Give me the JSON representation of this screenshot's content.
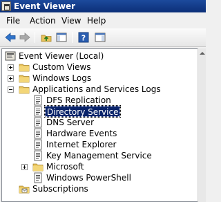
{
  "window": {
    "title": "Event Viewer",
    "app_icon": "event-viewer-icon"
  },
  "menu": {
    "items": [
      "File",
      "Action",
      "View",
      "Help"
    ]
  },
  "toolbar": {
    "buttons": [
      {
        "icon": "back-arrow-icon"
      },
      {
        "icon": "forward-arrow-icon"
      },
      {
        "icon": "up-folder-icon"
      },
      {
        "icon": "show-hide-console-tree-icon"
      },
      {
        "icon": "help-icon"
      },
      {
        "icon": "show-hide-action-pane-icon"
      }
    ]
  },
  "tree": {
    "root": "Event Viewer (Local)",
    "items": [
      {
        "label": "Custom Views",
        "expander": "+",
        "icon": "folder-icon"
      },
      {
        "label": "Windows Logs",
        "expander": "+",
        "icon": "folder-icon"
      },
      {
        "label": "Applications and Services Logs",
        "expander": "-",
        "icon": "folder-icon"
      },
      {
        "label": "DFS Replication",
        "icon": "log-icon"
      },
      {
        "label": "Directory Service",
        "icon": "log-icon",
        "selected": true
      },
      {
        "label": "DNS Server",
        "icon": "log-icon"
      },
      {
        "label": "Hardware Events",
        "icon": "log-icon"
      },
      {
        "label": "Internet Explorer",
        "icon": "log-icon"
      },
      {
        "label": "Key Management Service",
        "icon": "log-icon"
      },
      {
        "label": "Microsoft",
        "expander": "+",
        "icon": "folder-icon"
      },
      {
        "label": "Windows PowerShell",
        "icon": "log-icon"
      },
      {
        "label": "Subscriptions",
        "icon": "subscriptions-icon"
      }
    ]
  },
  "colors": {
    "titlebar": "#0c2f78",
    "selection": "#0a246a",
    "folder": "#e8c25a"
  }
}
